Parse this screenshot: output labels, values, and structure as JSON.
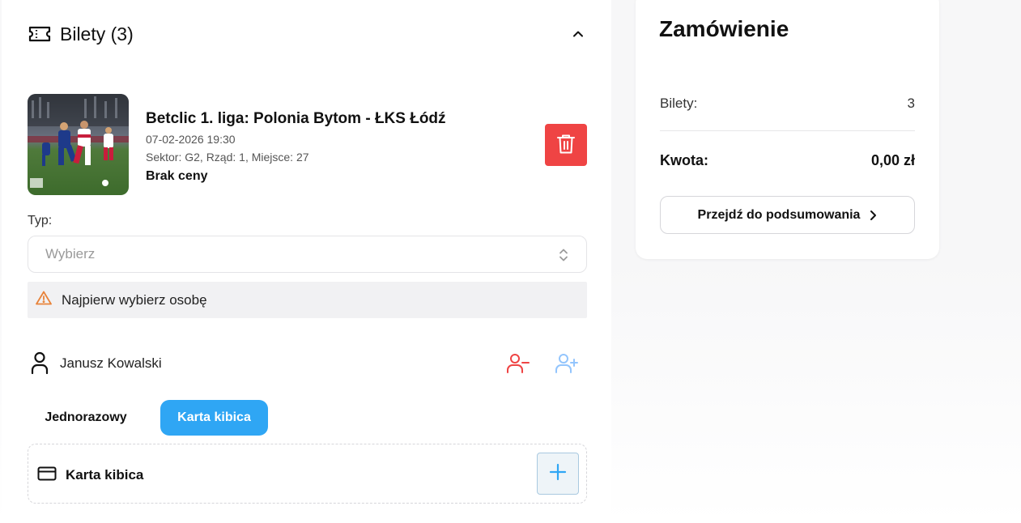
{
  "tickets_section": {
    "title": "Bilety (3)",
    "icon": "ticket-icon"
  },
  "ticket": {
    "event_title": "Betclic 1. liga: Polonia Bytom - ŁKS Łódź",
    "date": "07-02-2026 19:30",
    "seat": "Sektor: G2, Rząd: 1, Miejsce: 27",
    "price": "Brak ceny",
    "type_label": "Typ:",
    "type_placeholder": "Wybierz",
    "warning": "Najpierw wybierz osobę",
    "person_name": "Janusz Kowalski",
    "tabs": {
      "single": "Jednorazowy",
      "card": "Karta kibica"
    },
    "card_box_label": "Karta kibica"
  },
  "order": {
    "title": "Zamówienie",
    "tickets_label": "Bilety:",
    "tickets_count": "3",
    "amount_label": "Kwota:",
    "amount_value": "0,00 zł",
    "summary_button": "Przejdź do podsumowania"
  },
  "colors": {
    "danger": "#ef4444",
    "accent": "#2fa6f4",
    "warning_icon": "#e8833a",
    "add_person": "#93c5fd"
  }
}
